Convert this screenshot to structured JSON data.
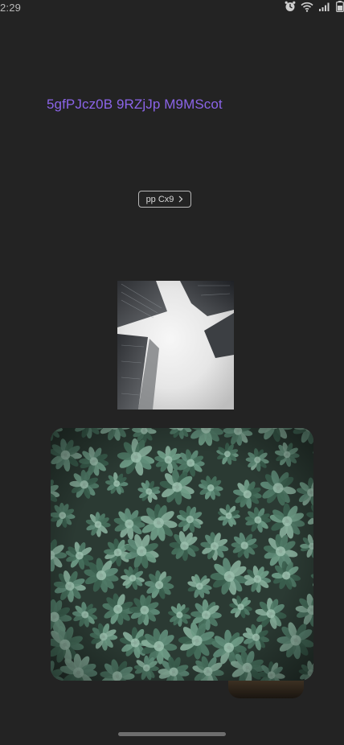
{
  "status_bar": {
    "time": "2:29",
    "icons": [
      "alarm-icon",
      "wifi-icon",
      "signal-icon",
      "battery-icon"
    ]
  },
  "title": "5gfPJcz0B 9RZjJp M9MScot",
  "button": {
    "label": "pp Cx9",
    "icon": "chevron-right-icon"
  },
  "images": [
    {
      "name": "building-photo"
    },
    {
      "name": "succulent-photo"
    }
  ],
  "colors": {
    "background": "#232323",
    "title": "#8b64e8",
    "button_border": "#b8b8b8"
  }
}
